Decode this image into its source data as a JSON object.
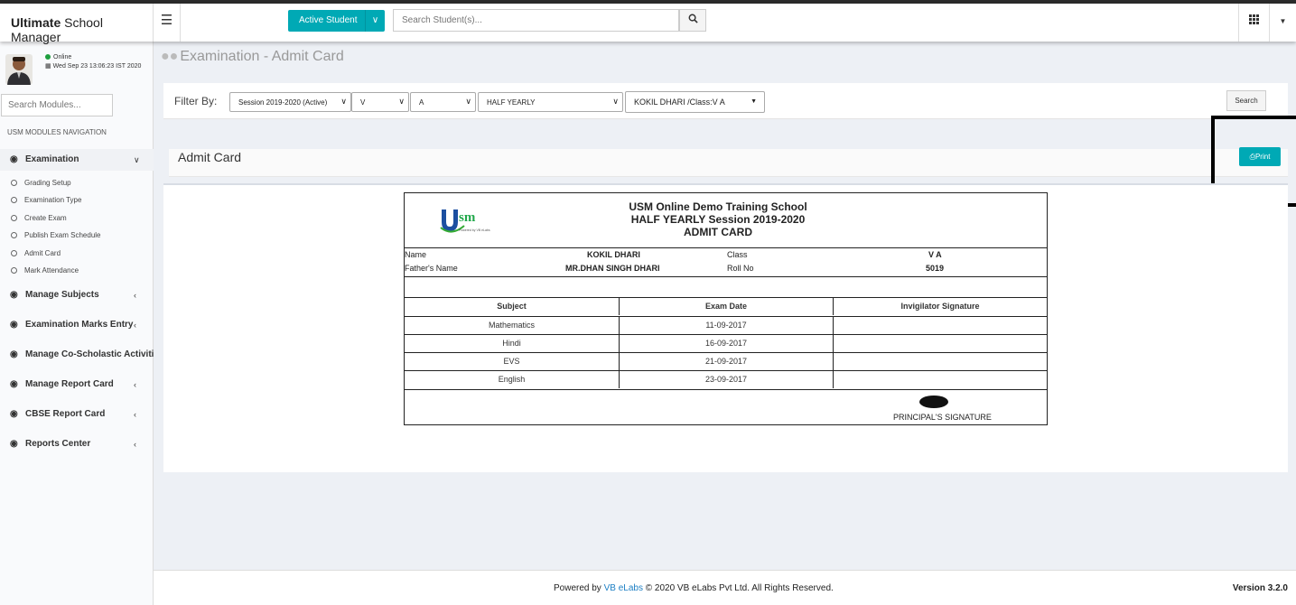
{
  "brand": {
    "bold": "Ultimate",
    "rest": " School Manager"
  },
  "header": {
    "active_student_label": "Active Student",
    "search_placeholder": "Search Student(s)..."
  },
  "user": {
    "status": "Online",
    "datetime": "Wed Sep 23 13:06:23 IST 2020"
  },
  "sidebar": {
    "search_placeholder": "Search Modules...",
    "heading": "USM MODULES NAVIGATION",
    "open_section": "Examination",
    "sub_items": [
      "Grading Setup",
      "Examination Type",
      "Create Exam",
      "Publish Exam Schedule",
      "Admit Card",
      "Mark Attendance"
    ],
    "sections": [
      "Manage Subjects",
      "Examination Marks Entry",
      "Manage Co-Scholastic Activities",
      "Manage Report Card",
      "CBSE Report Card",
      "Reports Center"
    ]
  },
  "page": {
    "title": "Examination - Admit Card"
  },
  "filter": {
    "label": "Filter By:",
    "session": "Session 2019-2020 (Active)",
    "class": "V",
    "section": "A",
    "exam": "HALF YEARLY",
    "student": "KOKIL DHARI /Class:V A",
    "search_label": "Search"
  },
  "admit_card_header": {
    "title": "Admit Card",
    "print_label": "Print"
  },
  "card": {
    "logo_text": "sm",
    "logo_tag": "Powered by VB eLabs",
    "school_name": "USM Online Demo Training School",
    "session_line": "HALF YEARLY Session 2019-2020",
    "card_title": "ADMIT CARD",
    "name_label": "Name",
    "name_value": "KOKIL DHARI",
    "class_label": "Class",
    "class_value": "V A",
    "father_label": "Father's Name",
    "father_value": "MR.DHAN SINGH DHARI",
    "roll_label": "Roll No",
    "roll_value": "5019",
    "columns": [
      "Subject",
      "Exam Date",
      "Invigilator Signature"
    ],
    "rows": [
      {
        "subject": "Mathematics",
        "date": "11-09-2017"
      },
      {
        "subject": "Hindi",
        "date": "16-09-2017"
      },
      {
        "subject": "EVS",
        "date": "21-09-2017"
      },
      {
        "subject": "English",
        "date": "23-09-2017"
      }
    ],
    "principal_signature": "PRINCIPAL'S SIGNATURE"
  },
  "footer": {
    "powered_by": "Powered by ",
    "link_text": "VB eLabs",
    "copyright": " © 2020 VB eLabs Pvt Ltd. All Rights Reserved.",
    "version": "Version 3.2.0"
  },
  "colors": {
    "accent": "#00a9b5",
    "link": "#1d7fc4",
    "online": "#1e9e3e"
  }
}
